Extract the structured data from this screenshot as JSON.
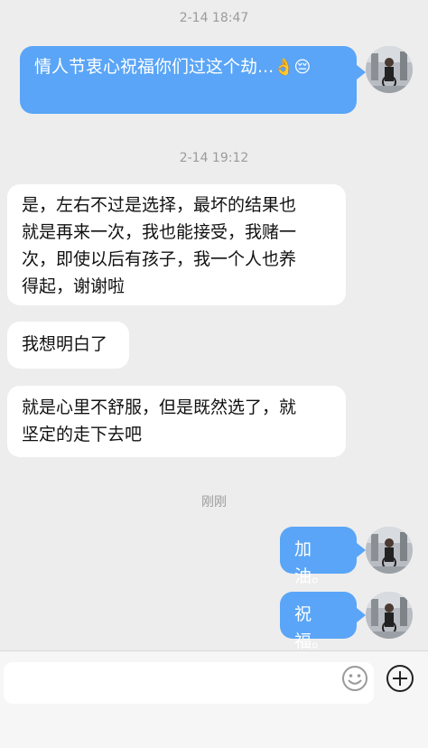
{
  "messages": [
    {
      "type": "timestamp",
      "text": "2-14 18:47"
    },
    {
      "type": "sent",
      "text": "情人节衷心祝福你们过这个劫...",
      "emojis": "👌😔"
    },
    {
      "type": "timestamp",
      "text": "2-14 19:12"
    },
    {
      "type": "received",
      "lines": [
        "是，左右不过是选择，最坏的结果也",
        "就是再来一次，我也能接受，我赌一",
        "次，即使以后有孩子，我一个人也养",
        "得起，谢谢啦"
      ]
    },
    {
      "type": "received",
      "text": "我想明白了"
    },
    {
      "type": "received",
      "lines": [
        "就是心里不舒服，但是既然选了，就",
        "坚定的走下去吧"
      ]
    },
    {
      "type": "timestamp",
      "text": "刚刚"
    },
    {
      "type": "sent",
      "text": "加油。"
    },
    {
      "type": "sent",
      "text": "祝福。"
    }
  ],
  "input_bar": {
    "value": "",
    "placeholder": ""
  },
  "icons": {
    "emoji": "emoji-icon",
    "add": "plus-circle-icon"
  },
  "colors": {
    "sent_bubble": "#5aa5f7",
    "received_bubble": "#ffffff",
    "background": "#ededed"
  }
}
